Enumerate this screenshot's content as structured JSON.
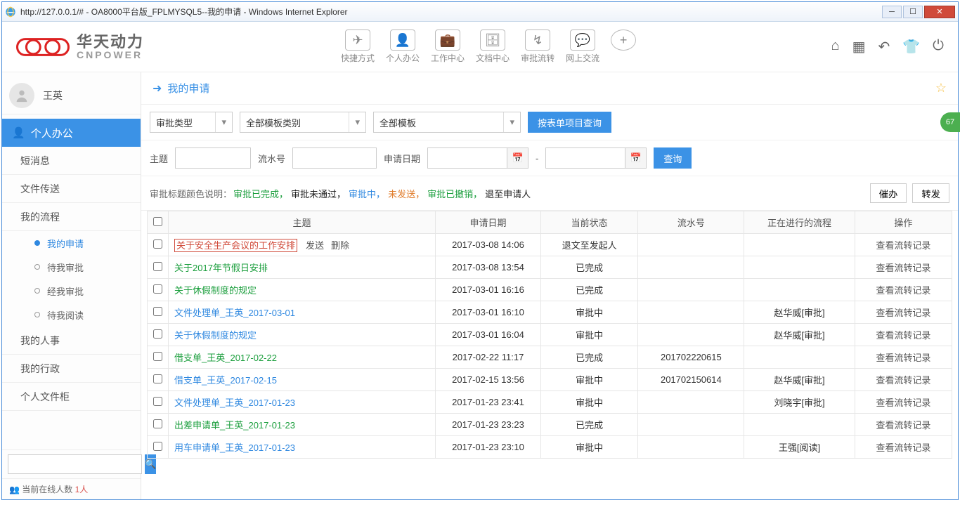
{
  "window": {
    "url": "http://127.0.0.1/#",
    "title_suffix": " - OA8000平台版_FPLMYSQL5--我的申请 - Windows Internet Explorer"
  },
  "logo": {
    "cn": "华天动力",
    "en": "CNPOWER"
  },
  "topnav": [
    {
      "label": "快捷方式",
      "glyph": "✈"
    },
    {
      "label": "个人办公",
      "glyph": "👤"
    },
    {
      "label": "工作中心",
      "glyph": "💼"
    },
    {
      "label": "文档中心",
      "glyph": "🗄"
    },
    {
      "label": "审批流转",
      "glyph": "↯"
    },
    {
      "label": "网上交流",
      "glyph": "💬"
    }
  ],
  "topnav_plus_glyph": "+",
  "user": {
    "name": "王英"
  },
  "sidebar": {
    "group": "个人办公",
    "items": [
      "短消息",
      "文件传送",
      "我的流程",
      "我的人事",
      "我的行政",
      "个人文件柜"
    ],
    "subs": [
      "我的申请",
      "待我审批",
      "经我审批",
      "待我阅读"
    ],
    "online_label": "当前在线人数 ",
    "online_count": "1人"
  },
  "page_title": "我的申请",
  "filters": {
    "f1": "审批类型",
    "f2": "全部模板类别",
    "f3": "全部模板",
    "by_form_btn": "按表单项目查询",
    "subject_label": "主题",
    "serial_label": "流水号",
    "date_label": "申请日期",
    "dash": "-",
    "query_btn": "查询"
  },
  "legend": {
    "prefix": "审批标题颜色说明：",
    "done": "审批已完成，",
    "fail": "审批未通过，",
    "in": "审批中，",
    "unsent": "未发送，",
    "revoke": "审批已撤销，",
    "back": "退至申请人",
    "btn1": "催办",
    "btn2": "转发"
  },
  "table": {
    "headers": [
      "",
      "主题",
      "申请日期",
      "当前状态",
      "流水号",
      "正在进行的流程",
      "操作"
    ],
    "row_action_send": "发送",
    "row_action_del": "删除",
    "view_label": "查看流转记录",
    "rows": [
      {
        "subject": "关于安全生产会议的工作安排",
        "style": "back",
        "has_actions": true,
        "date": "2017-03-08 14:06",
        "status": "退文至发起人",
        "serial": "",
        "flow": ""
      },
      {
        "subject": "关于2017年节假日安排",
        "style": "done",
        "date": "2017-03-08 13:54",
        "status": "已完成",
        "serial": "",
        "flow": ""
      },
      {
        "subject": "关于休假制度的规定",
        "style": "done",
        "date": "2017-03-01 16:16",
        "status": "已完成",
        "serial": "",
        "flow": ""
      },
      {
        "subject": "文件处理单_王英_2017-03-01",
        "style": "in",
        "date": "2017-03-01 16:10",
        "status": "审批中",
        "serial": "",
        "flow": "赵华威[审批]"
      },
      {
        "subject": "关于休假制度的规定",
        "style": "in",
        "date": "2017-03-01 16:04",
        "status": "审批中",
        "serial": "",
        "flow": "赵华威[审批]"
      },
      {
        "subject": "借支单_王英_2017-02-22",
        "style": "done",
        "date": "2017-02-22 11:17",
        "status": "已完成",
        "serial": "201702220615",
        "flow": ""
      },
      {
        "subject": "借支单_王英_2017-02-15",
        "style": "in",
        "date": "2017-02-15 13:56",
        "status": "审批中",
        "serial": "201702150614",
        "flow": "赵华威[审批]"
      },
      {
        "subject": "文件处理单_王英_2017-01-23",
        "style": "in",
        "date": "2017-01-23 23:41",
        "status": "审批中",
        "serial": "",
        "flow": "刘晓宇[审批]"
      },
      {
        "subject": "出差申请单_王英_2017-01-23",
        "style": "done",
        "date": "2017-01-23 23:23",
        "status": "已完成",
        "serial": "",
        "flow": ""
      },
      {
        "subject": "用车申请单_王英_2017-01-23",
        "style": "in",
        "date": "2017-01-23 23:10",
        "status": "审批中",
        "serial": "",
        "flow": "王强[阅读]"
      }
    ]
  },
  "float_badge": "67"
}
